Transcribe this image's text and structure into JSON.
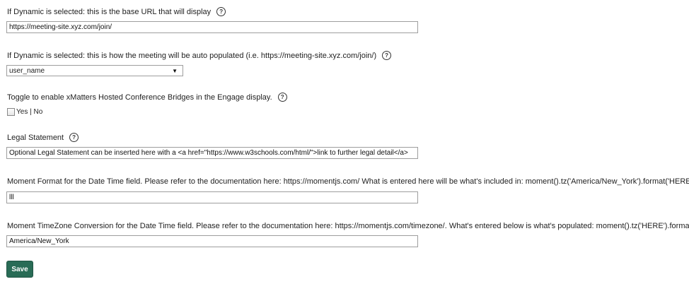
{
  "fields": {
    "base_url": {
      "label": "If Dynamic is selected: this is the base URL that will display",
      "value": "https://meeting-site.xyz.com/join/"
    },
    "auto_populate": {
      "label": "If Dynamic is selected: this is how the meeting will be auto populated (i.e. https://meeting-site.xyz.com/join/)",
      "selected": "user_name"
    },
    "toggle": {
      "label": "Toggle to enable xMatters Hosted Conference Bridges in the Engage display.",
      "option_text": "Yes | No"
    },
    "legal": {
      "label": "Legal Statement",
      "value": "Optional Legal Statement can be inserted here with a <a href=\"https://www.w3schools.com/html/\">link to further legal detail</a>"
    },
    "moment_format": {
      "label": "Moment Format for the Date Time field. Please refer to the documentation here: https://momentjs.com/ What is entered here will be what's included in: moment().tz('America/New_York').format('HERE')",
      "value": "lll"
    },
    "timezone": {
      "label": "Moment TimeZone Conversion for the Date Time field. Please refer to the documentation here: https://momentjs.com/timezone/. What's entered below is what's populated: moment().tz('HERE').format('lll')",
      "value": "America/New_York"
    }
  },
  "help_glyph": "?",
  "select_arrow": "▼",
  "save_label": "Save",
  "colors": {
    "save_button": "#296c56"
  }
}
